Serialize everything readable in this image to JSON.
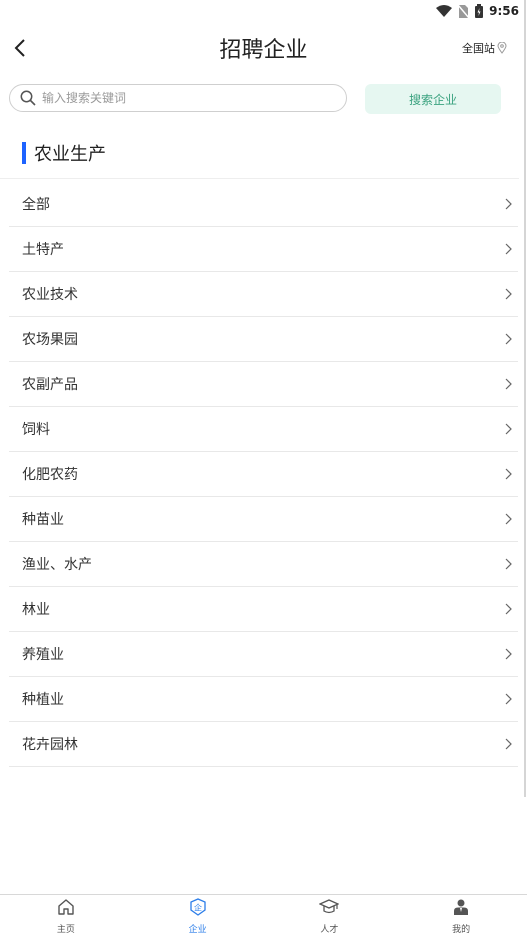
{
  "status_bar": {
    "time": "9:56"
  },
  "header": {
    "title": "招聘企业",
    "site": "全国站"
  },
  "search": {
    "placeholder": "输入搜索关键词",
    "value": "",
    "button_label": "搜索企业"
  },
  "section": {
    "title": "农业生产"
  },
  "categories": [
    {
      "label": "全部"
    },
    {
      "label": "土特产"
    },
    {
      "label": "农业技术"
    },
    {
      "label": "农场果园"
    },
    {
      "label": "农副产品"
    },
    {
      "label": "饲料"
    },
    {
      "label": "化肥农药"
    },
    {
      "label": "种苗业"
    },
    {
      "label": "渔业、水产"
    },
    {
      "label": "林业"
    },
    {
      "label": "养殖业"
    },
    {
      "label": "种植业"
    },
    {
      "label": "花卉园林"
    }
  ],
  "tabbar": {
    "items": [
      {
        "label": "主页",
        "icon": "home-icon"
      },
      {
        "label": "企业",
        "icon": "enterprise-icon",
        "active": true
      },
      {
        "label": "人才",
        "icon": "graduation-cap-icon"
      },
      {
        "label": "我的",
        "icon": "user-icon"
      }
    ]
  },
  "colors": {
    "accent_blue": "#1e63ff",
    "search_button_bg": "#e6f7f1",
    "search_button_text": "#3aa27f",
    "tab_active": "#2b7de9"
  }
}
